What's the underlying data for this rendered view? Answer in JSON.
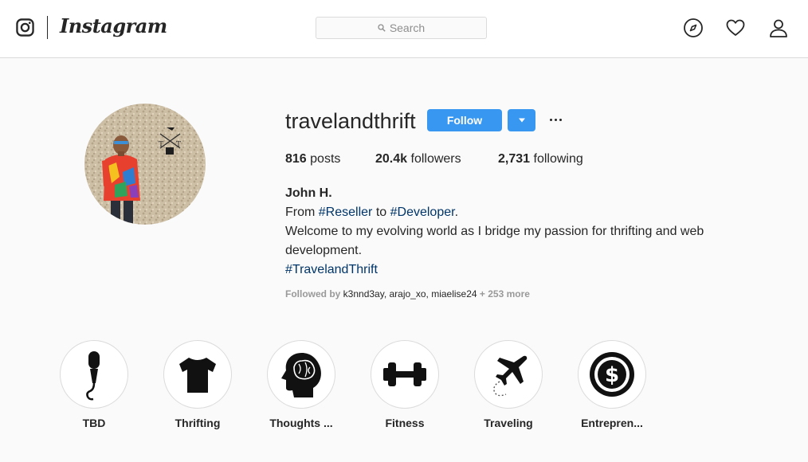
{
  "nav": {
    "brand": "Instagram",
    "search_placeholder": "Search",
    "icons": [
      "instagram-glyph-icon",
      "search-icon",
      "compass-icon",
      "heart-icon",
      "user-icon"
    ]
  },
  "profile": {
    "username": "travelandthrift",
    "follow_label": "Follow",
    "stats": {
      "posts_count": "816",
      "posts_label": " posts",
      "followers_count": "20.4k",
      "followers_label": " followers",
      "following_count": "2,731",
      "following_label": " following"
    },
    "bio": {
      "name": "John H.",
      "line1_a": "From ",
      "line1_tag1": "#Reseller",
      "line1_b": " to ",
      "line1_tag2": "#Developer",
      "line1_c": ".",
      "line2": "Welcome to my evolving world as I bridge my passion for thrifting and web development.",
      "line3_tag": "#TravelandThrift"
    },
    "followed_by": {
      "prefix": "Followed by ",
      "acct1": "k3nnd3ay",
      "sep1": ", ",
      "acct2": "arajo_xo",
      "sep2": ", ",
      "acct3": "miaelise24",
      "suffix": " + 253 more"
    }
  },
  "highlights": [
    {
      "label": "TBD",
      "icon": "microphone-icon"
    },
    {
      "label": "Thrifting",
      "icon": "tshirt-icon"
    },
    {
      "label": "Thoughts ...",
      "icon": "brain-head-icon"
    },
    {
      "label": "Fitness",
      "icon": "dumbbell-icon"
    },
    {
      "label": "Traveling",
      "icon": "airplane-icon"
    },
    {
      "label": "Entrepren...",
      "icon": "dollar-coin-icon"
    }
  ],
  "colors": {
    "accent": "#3897f0",
    "hashtag": "#003569",
    "border": "#dbdbdb",
    "background": "#fafafa"
  }
}
